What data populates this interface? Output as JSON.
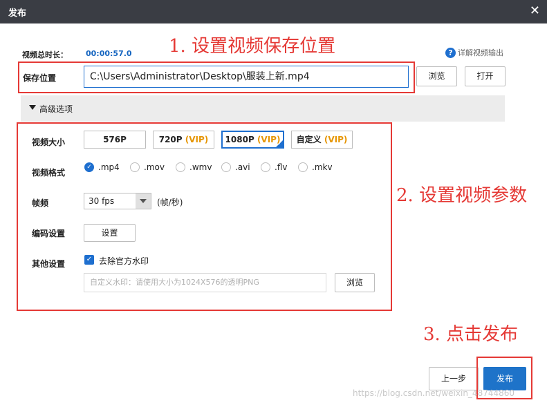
{
  "window": {
    "title": "发布",
    "close_glyph": "✕"
  },
  "annotations": {
    "step1": "1. 设置视频保存位置",
    "step2": "2. 设置视频参数",
    "step3": "3. 点击发布"
  },
  "info": {
    "duration_label": "视频总时长：",
    "duration_value": "00:00:57.0",
    "help_link": "详解视频输出"
  },
  "save": {
    "label": "保存位置",
    "path": "C:\\Users\\Administrator\\Desktop\\服装上新.mp4",
    "browse_button": "浏览",
    "open_button": "打开"
  },
  "advanced": {
    "toggle_label": "高级选项",
    "size": {
      "label": "视频大小",
      "options": [
        {
          "label": "576P",
          "vip": ""
        },
        {
          "label": "720P",
          "vip": "(VIP)"
        },
        {
          "label": "1080P",
          "vip": "(VIP)"
        },
        {
          "label": "自定义",
          "vip": "(VIP)"
        }
      ],
      "selected": "1080P"
    },
    "format": {
      "label": "视频格式",
      "options": [
        ".mp4",
        ".mov",
        ".wmv",
        ".avi",
        ".flv",
        ".mkv"
      ],
      "selected": ".mp4"
    },
    "fps": {
      "label": "帧频",
      "value": "30 fps",
      "unit": "(帧/秒)"
    },
    "encoding": {
      "label": "编码设置",
      "button": "设置"
    },
    "other": {
      "label": "其他设置",
      "remove_watermark_label": "去除官方水印",
      "remove_watermark_checked": true,
      "custom_watermark_placeholder": "自定义水印：请使用大小为1024X576的透明PNG",
      "browse_button": "浏览"
    }
  },
  "footer": {
    "prev_button": "上一步",
    "publish_button": "发布",
    "watermark_text": "https://blog.csdn.net/weixin_48744860"
  },
  "colors": {
    "titlebar": "#3a3d44",
    "accent": "#1e6fcf",
    "annotation_red": "#e53935",
    "vip_orange": "#e69500"
  }
}
